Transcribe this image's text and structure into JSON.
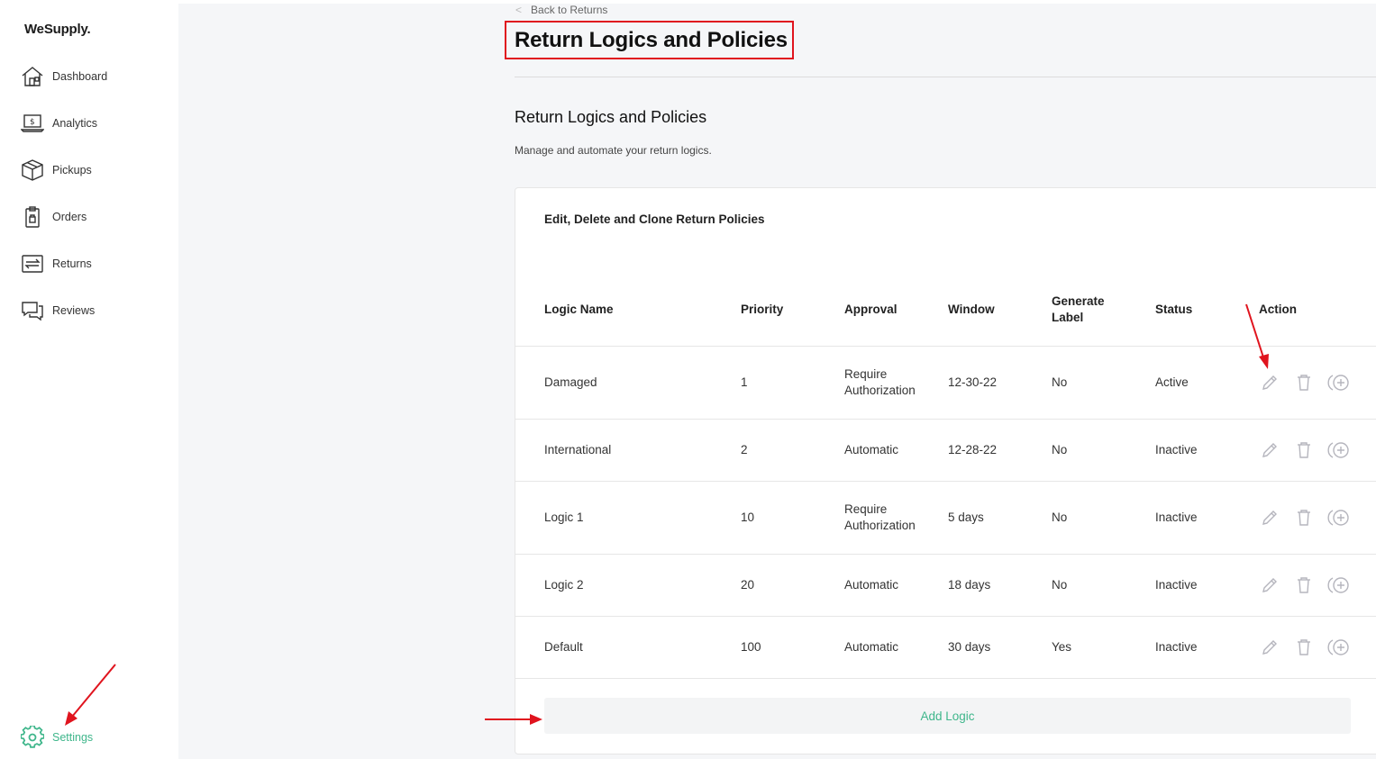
{
  "app": {
    "logo": "WeSupply."
  },
  "sidebar": {
    "items": [
      {
        "label": "Dashboard",
        "icon": "home-icon"
      },
      {
        "label": "Analytics",
        "icon": "analytics-icon"
      },
      {
        "label": "Pickups",
        "icon": "box-icon"
      },
      {
        "label": "Orders",
        "icon": "clipboard-icon"
      },
      {
        "label": "Returns",
        "icon": "returns-icon"
      },
      {
        "label": "Reviews",
        "icon": "chat-icon"
      }
    ],
    "settings": {
      "label": "Settings",
      "icon": "gear-icon"
    }
  },
  "header": {
    "back_label": "Back to Returns",
    "title": "Return Logics and Policies"
  },
  "section": {
    "title": "Return Logics and Policies",
    "subtitle": "Manage and automate your return logics."
  },
  "card": {
    "title": "Edit, Delete and Clone Return Policies",
    "columns": {
      "logic_name": "Logic Name",
      "priority": "Priority",
      "approval": "Approval",
      "window": "Window",
      "generate_label_1": "Generate",
      "generate_label_2": "Label",
      "status": "Status",
      "action": "Action"
    },
    "rows": [
      {
        "name": "Damaged",
        "priority": "1",
        "approval_1": "Require",
        "approval_2": "Authorization",
        "window": "12-30-22",
        "generate": "No",
        "status": "Active"
      },
      {
        "name": "International",
        "priority": "2",
        "approval_1": "Automatic",
        "approval_2": "",
        "window": "12-28-22",
        "generate": "No",
        "status": "Inactive"
      },
      {
        "name": "Logic 1",
        "priority": "10",
        "approval_1": "Require",
        "approval_2": "Authorization",
        "window": "5 days",
        "generate": "No",
        "status": "Inactive"
      },
      {
        "name": "Logic 2",
        "priority": "20",
        "approval_1": "Automatic",
        "approval_2": "",
        "window": "18 days",
        "generate": "No",
        "status": "Inactive"
      },
      {
        "name": "Default",
        "priority": "100",
        "approval_1": "Automatic",
        "approval_2": "",
        "window": "30 days",
        "generate": "Yes",
        "status": "Inactive"
      }
    ],
    "add_button": "Add Logic"
  },
  "colors": {
    "accent": "#3fb68b",
    "highlight": "#e0141e",
    "icon_gray": "#b5b5bd"
  }
}
